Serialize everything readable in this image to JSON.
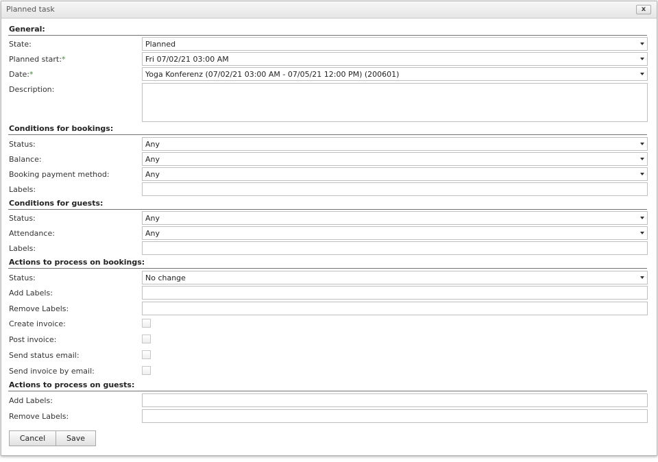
{
  "dialog": {
    "title": "Planned task",
    "close_glyph": "x"
  },
  "general": {
    "heading": "General:",
    "state_label": "State:",
    "state_value": "Planned",
    "planned_start_label": "Planned start:",
    "planned_start_value": "Fri 07/02/21 03:00 AM",
    "date_label": "Date:",
    "date_value": "Yoga Konferenz (07/02/21 03:00 AM - 07/05/21 12:00 PM) (200601)",
    "description_label": "Description:",
    "description_value": "",
    "required_mark": "*"
  },
  "booking_conditions": {
    "heading": "Conditions for bookings:",
    "status_label": "Status:",
    "status_value": "Any",
    "balance_label": "Balance:",
    "balance_value": "Any",
    "payment_label": "Booking payment method:",
    "payment_value": "Any",
    "labels_label": "Labels:",
    "labels_value": ""
  },
  "guest_conditions": {
    "heading": "Conditions for guests:",
    "status_label": "Status:",
    "status_value": "Any",
    "attendance_label": "Attendance:",
    "attendance_value": "Any",
    "labels_label": "Labels:",
    "labels_value": ""
  },
  "booking_actions": {
    "heading": "Actions to process on bookings:",
    "status_label": "Status:",
    "status_value": "No change",
    "add_labels_label": "Add Labels:",
    "add_labels_value": "",
    "remove_labels_label": "Remove Labels:",
    "remove_labels_value": "",
    "create_invoice_label": "Create invoice:",
    "create_invoice_checked": false,
    "post_invoice_label": "Post invoice:",
    "post_invoice_checked": false,
    "send_status_email_label": "Send status email:",
    "send_status_email_checked": false,
    "send_invoice_email_label": "Send invoice by email:",
    "send_invoice_email_checked": false
  },
  "guest_actions": {
    "heading": "Actions to process on guests:",
    "add_labels_label": "Add Labels:",
    "add_labels_value": "",
    "remove_labels_label": "Remove Labels:",
    "remove_labels_value": ""
  },
  "buttons": {
    "cancel": "Cancel",
    "save": "Save"
  },
  "icons": {
    "close": "close-icon",
    "dropdown": "chevron-down-icon"
  }
}
